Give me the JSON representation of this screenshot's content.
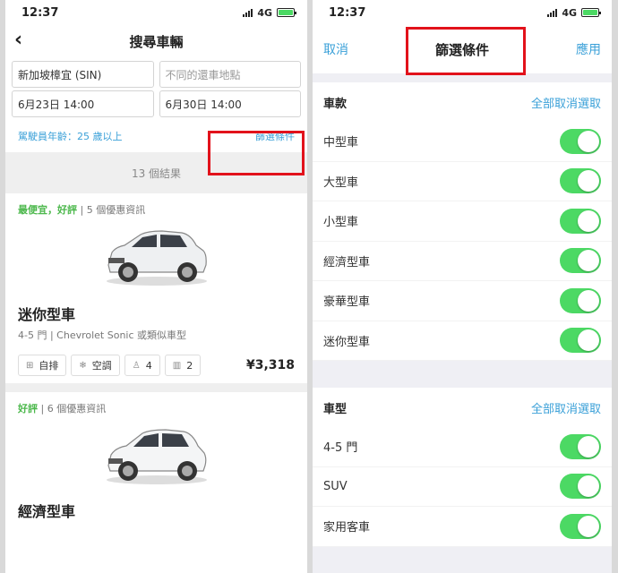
{
  "left": {
    "status": {
      "time": "12:37",
      "network": "4G"
    },
    "nav": {
      "title": "搜尋車輛",
      "back_icon": "chevron-left-icon"
    },
    "search": {
      "pickup_location": "新加坡樟宜 (SIN)",
      "return_location_placeholder": "不同的還車地點",
      "pickup_datetime": "6月23日 14:00",
      "return_datetime": "6月30日 14:00"
    },
    "driver_age": "駕駛員年齡：25 歲以上",
    "filter_link": "篩選條件",
    "results_count": "13 個結果",
    "cars": [
      {
        "tag": "最便宜，好評",
        "deals": "| 5 個優惠資訊",
        "name": "迷你型車",
        "subtitle": "4-5 門 | Chevrolet Sonic 或類似車型",
        "transmission": "自排",
        "ac": "空調",
        "seats": "4",
        "bags": "2",
        "price": "¥3,318"
      },
      {
        "tag": "好評",
        "deals": "| 6 個優惠資訊",
        "name": "經濟型車"
      }
    ]
  },
  "right": {
    "status": {
      "time": "12:37",
      "network": "4G"
    },
    "nav": {
      "cancel": "取消",
      "title": "篩選條件",
      "apply": "應用"
    },
    "sections": [
      {
        "title": "車款",
        "action": "全部取消選取",
        "options": [
          "中型車",
          "大型車",
          "小型車",
          "經濟型車",
          "豪華型車",
          "迷你型車"
        ]
      },
      {
        "title": "車型",
        "action": "全部取消選取",
        "options": [
          "4-5 門",
          "SUV",
          "家用客車"
        ]
      }
    ]
  },
  "colors": {
    "accent": "#3aa0d8",
    "toggle_on": "#4cd964",
    "deal_green": "#4cb84c",
    "highlight_red": "#e2121b"
  }
}
